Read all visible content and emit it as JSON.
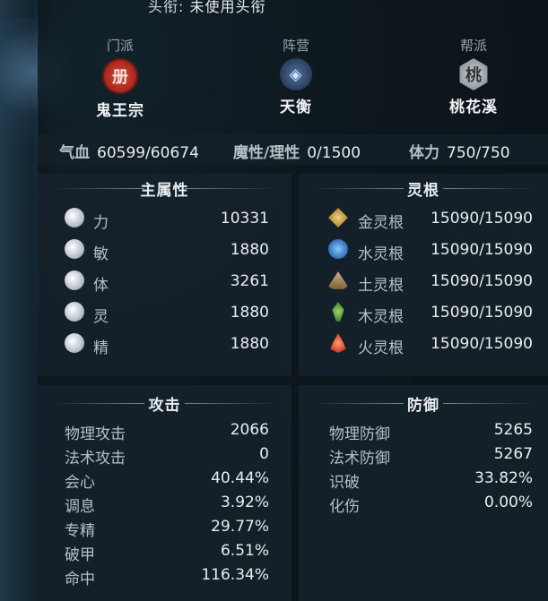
{
  "title_bar": {
    "label": "头衔:",
    "value": "未使用头衔"
  },
  "factions": [
    {
      "caption": "门派",
      "name": "鬼王宗",
      "emblem": "册"
    },
    {
      "caption": "阵营",
      "name": "天衡",
      "emblem": "◈"
    },
    {
      "caption": "帮派",
      "name": "桃花溪",
      "emblem": "桃"
    }
  ],
  "vitals": {
    "hp_label": "气血",
    "hp_value": "60599/60674",
    "mana_label": "魔性/理性",
    "mana_value": "0/1500",
    "stamina_label": "体力",
    "stamina_value": "750/750"
  },
  "main_attributes": {
    "title": "主属性",
    "items": [
      {
        "label": "力",
        "value": "10331",
        "icon": "strength-icon"
      },
      {
        "label": "敏",
        "value": "1880",
        "icon": "agility-icon"
      },
      {
        "label": "体",
        "value": "3261",
        "icon": "constitution-icon"
      },
      {
        "label": "灵",
        "value": "1880",
        "icon": "spirit-icon"
      },
      {
        "label": "精",
        "value": "1880",
        "icon": "essence-icon"
      }
    ]
  },
  "spirit_roots": {
    "title": "灵根",
    "items": [
      {
        "label": "金灵根",
        "value": "15090/15090",
        "icon": "metal-root-icon"
      },
      {
        "label": "水灵根",
        "value": "15090/15090",
        "icon": "water-root-icon"
      },
      {
        "label": "土灵根",
        "value": "15090/15090",
        "icon": "earth-root-icon"
      },
      {
        "label": "木灵根",
        "value": "15090/15090",
        "icon": "wood-root-icon"
      },
      {
        "label": "火灵根",
        "value": "15090/15090",
        "icon": "fire-root-icon"
      }
    ]
  },
  "attack": {
    "title": "攻击",
    "items": [
      {
        "label": "物理攻击",
        "value": "2066"
      },
      {
        "label": "法术攻击",
        "value": "0"
      },
      {
        "label": "会心",
        "value": "40.44%"
      },
      {
        "label": "调息",
        "value": "3.92%"
      },
      {
        "label": "专精",
        "value": "29.77%"
      },
      {
        "label": "破甲",
        "value": "6.51%"
      },
      {
        "label": "命中",
        "value": "116.34%"
      }
    ]
  },
  "defense": {
    "title": "防御",
    "items": [
      {
        "label": "物理防御",
        "value": "5265"
      },
      {
        "label": "法术防御",
        "value": "5267"
      },
      {
        "label": "识破",
        "value": "33.82%"
      },
      {
        "label": "化伤",
        "value": "0.00%"
      }
    ]
  }
}
